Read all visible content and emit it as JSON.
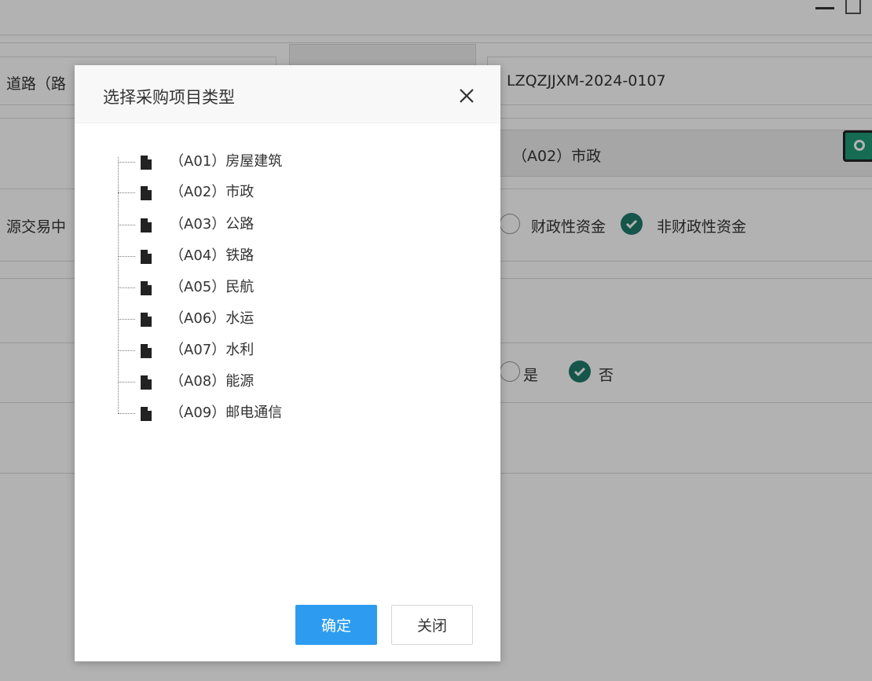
{
  "background": {
    "road_label": "道路（路",
    "project_code": "LZQZJJXM-2024-0107",
    "selected_type": "（A02）市政",
    "trade_center_label": "源交易中",
    "fund_option_1": "财政性资金",
    "fund_option_2": "非财政性资金",
    "yes_label": "是",
    "no_label": "否"
  },
  "modal": {
    "title": "选择采购项目类型",
    "tree_items": [
      "（A01）房屋建筑",
      "（A02）市政",
      "（A03）公路",
      "（A04）铁路",
      "（A05）民航",
      "（A06）水运",
      "（A07）水利",
      "（A08）能源",
      "（A09）邮电通信"
    ],
    "confirm_label": "确定",
    "close_label": "关闭"
  }
}
